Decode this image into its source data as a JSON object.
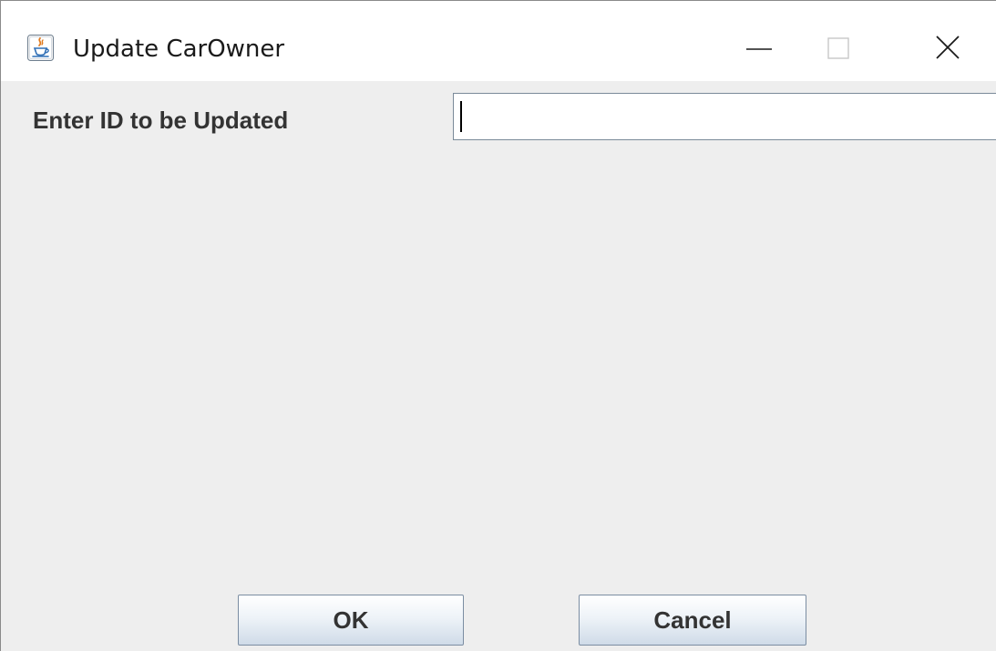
{
  "window": {
    "title": "Update CarOwner",
    "icon": "java-cup-icon",
    "controls": [
      "minimize-icon",
      "maximize-icon",
      "close-icon"
    ]
  },
  "form": {
    "id_label": "Enter ID to be Updated",
    "id_value": "",
    "id_placeholder": ""
  },
  "buttons": {
    "ok_label": "OK",
    "cancel_label": "Cancel"
  },
  "colors": {
    "dialog_background": "#eeeeee",
    "titlebar_background": "#ffffff",
    "button_border": "#7b8da2",
    "input_border": "#7a8a99"
  }
}
